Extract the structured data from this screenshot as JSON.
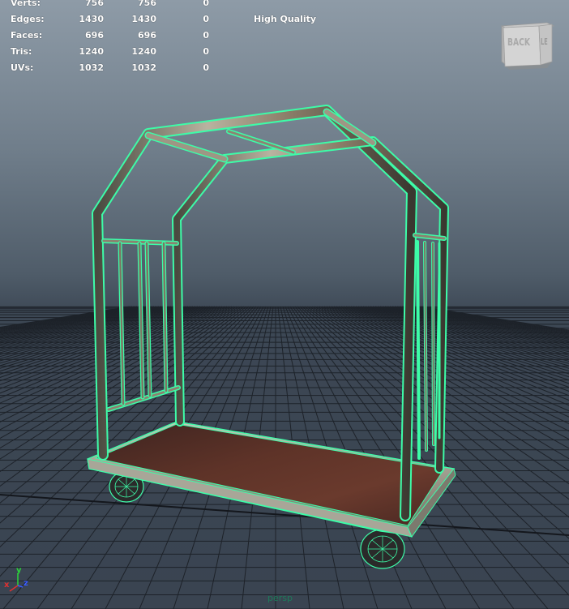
{
  "hud": {
    "rows": [
      {
        "label": "Verts:",
        "c1": "756",
        "c2": "756",
        "c3": "0"
      },
      {
        "label": "Edges:",
        "c1": "1430",
        "c2": "1430",
        "c3": "0"
      },
      {
        "label": "Faces:",
        "c1": "696",
        "c2": "696",
        "c3": "0"
      },
      {
        "label": "Tris:",
        "c1": "1240",
        "c2": "1240",
        "c3": "0"
      },
      {
        "label": "UVs:",
        "c1": "1032",
        "c2": "1032",
        "c3": "0"
      }
    ],
    "quality_label": "High Quality"
  },
  "viewcube": {
    "face_label": "BACK",
    "side_label": "LEFT"
  },
  "camera_name": "persp",
  "axis": {
    "x_label": "x",
    "y_label": "y",
    "z_label": "z"
  },
  "colors": {
    "wireframe": "#3dfca8",
    "grid": "#1a1a1a",
    "deck": "#5a2f25",
    "metal": "#8a8a7a"
  }
}
